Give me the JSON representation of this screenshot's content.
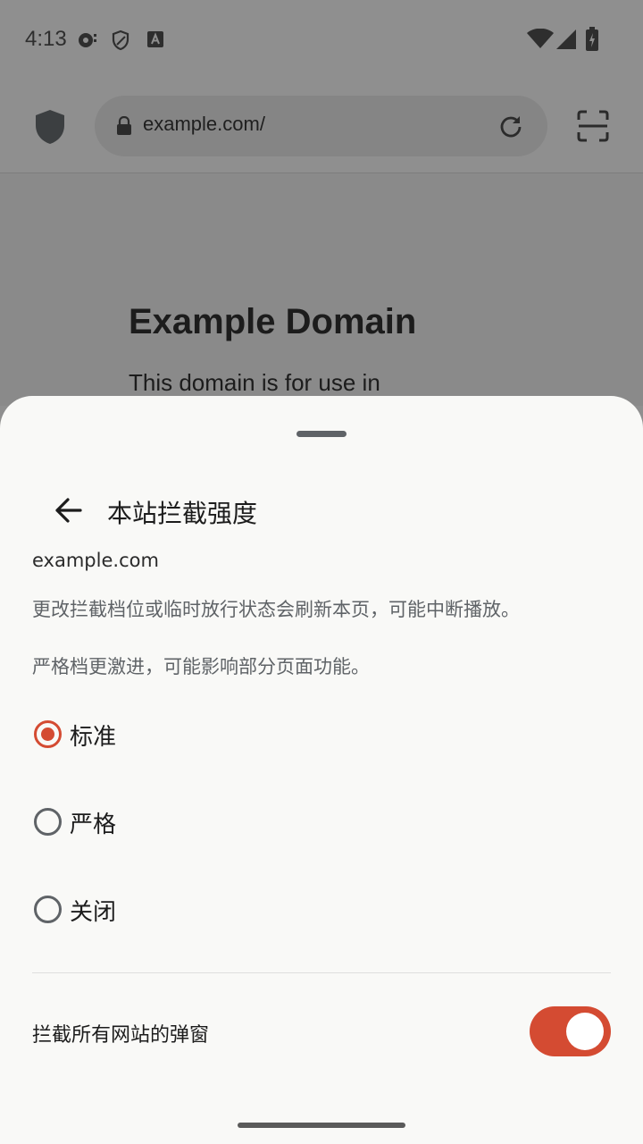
{
  "status_bar": {
    "time": "4:13",
    "icons_left": [
      "media-icon",
      "vpn-shield-icon",
      "keyboard-a-icon"
    ],
    "icons_right": [
      "wifi-icon",
      "cell-signal-icon",
      "battery-charging-icon"
    ]
  },
  "browser": {
    "url": "example.com/",
    "shield_icon": "shield-icon",
    "lock_icon": "lock-icon",
    "reload_icon": "reload-icon",
    "scan_icon": "scan-icon"
  },
  "page": {
    "title": "Example Domain",
    "text": "This domain is for use in"
  },
  "sheet": {
    "title": "本站拦截强度",
    "site": "example.com",
    "desc1": "更改拦截档位或临时放行状态会刷新本页，可能中断播放。",
    "desc2": "严格档更激进，可能影响部分页面功能。",
    "options": [
      {
        "label": "标准",
        "selected": true
      },
      {
        "label": "严格",
        "selected": false
      },
      {
        "label": "关闭",
        "selected": false
      }
    ],
    "popup_label": "拦截所有网站的弹窗",
    "popup_enabled": true
  },
  "colors": {
    "accent": "#d44b32",
    "scrim": "#8f8f8f",
    "sheet_bg": "#f9f9f7"
  }
}
